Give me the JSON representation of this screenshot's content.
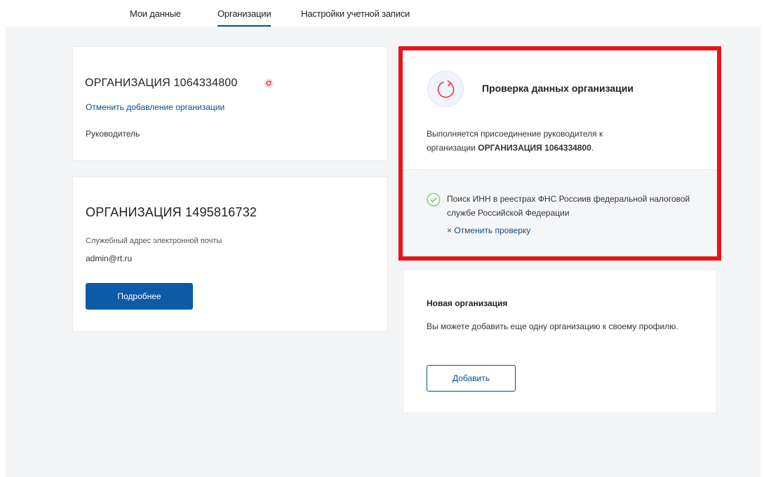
{
  "tabs": [
    {
      "label": "Мои данные"
    },
    {
      "label": "Организации",
      "active": true
    },
    {
      "label": "Настройки учетной записи"
    }
  ],
  "org1": {
    "name": "ОРГАНИЗАЦИЯ 1064334800",
    "cancel_link": "Отменить добавление организации",
    "role": "Руководитель",
    "status_icon": "pending-refresh-icon"
  },
  "org2": {
    "name": "ОРГАНИЗАЦИЯ 1495816732",
    "email_label": "Служебный адрес электронной почты",
    "email": "admin@rt.ru",
    "details_button": "Подробнее"
  },
  "check": {
    "title": "Проверка данных организации",
    "desc_prefix": "Выполняется присоединение руководителя к организации ",
    "desc_org": "ОРГАНИЗАЦИЯ 1064334800",
    "desc_suffix": ".",
    "step": "Поиск ИНН в реестрах ФНС Россиив федеральной налоговой службе Российской Федерации",
    "cancel_link": "× Отменить проверку",
    "icon": "refresh-icon",
    "step_icon": "check-circle-icon"
  },
  "new_org": {
    "title": "Новая организация",
    "text": "Вы можете добавить еще одну организацию к своему профилю.",
    "add_button": "Добавить"
  },
  "colors": {
    "accent": "#0d4c8b",
    "button": "#0d5aa7",
    "highlight": "#e8141c",
    "success": "#6ec26a",
    "pending": "#e53935"
  }
}
